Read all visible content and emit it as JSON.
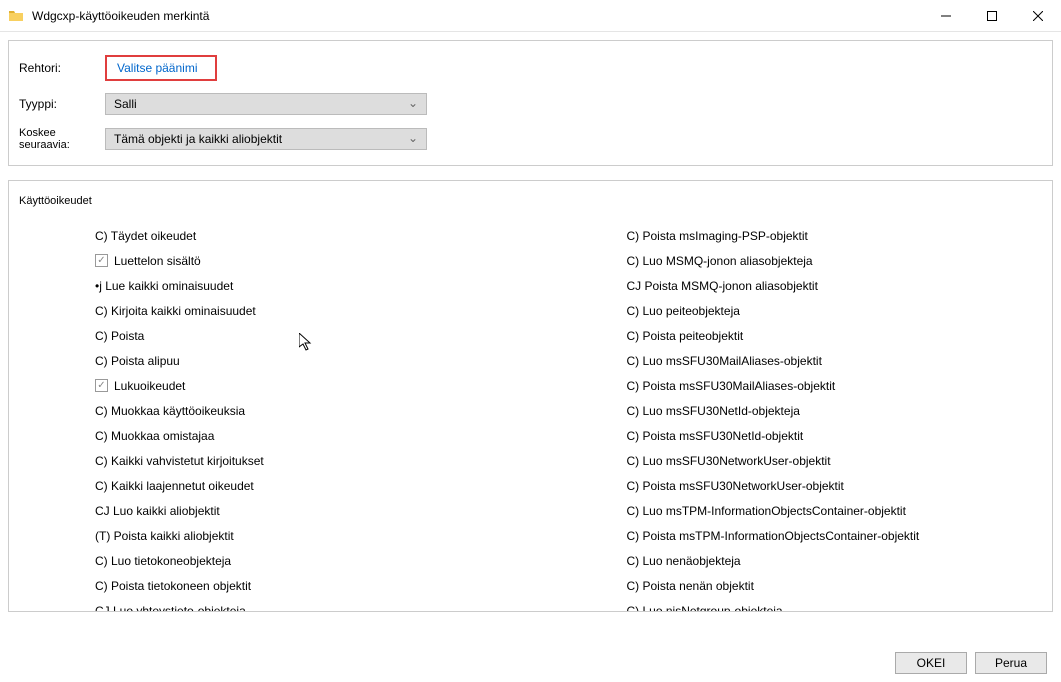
{
  "window": {
    "title": "Wdgcxp-käyttöoikeuden merkintä"
  },
  "fields": {
    "principal_label": "Rehtori:",
    "principal_link": "Valitse päänimi",
    "type_label": "Tyyppi:",
    "type_value": "Salli",
    "applies_label": "Koskee seuraavia:",
    "applies_value": "Tämä objekti ja kaikki aliobjektit"
  },
  "permissions": {
    "title": "Käyttöoikeudet",
    "left": [
      {
        "prefix": "C)",
        "label": "Täydet oikeudet",
        "checkbox": false
      },
      {
        "prefix": "",
        "label": "Luettelon sisältö",
        "checkbox": true,
        "checked": true
      },
      {
        "prefix": "•j",
        "label": "Lue kaikki ominaisuudet",
        "checkbox": false
      },
      {
        "prefix": "C)",
        "label": "Kirjoita kaikki ominaisuudet",
        "checkbox": false
      },
      {
        "prefix": "C)",
        "label": "Poista",
        "checkbox": false
      },
      {
        "prefix": "C)",
        "label": "Poista alipuu",
        "checkbox": false
      },
      {
        "prefix": "",
        "label": "Lukuoikeudet",
        "checkbox": true,
        "checked": true
      },
      {
        "prefix": "C)",
        "label": "Muokkaa käyttöoikeuksia",
        "checkbox": false
      },
      {
        "prefix": "C)",
        "label": "Muokkaa omistajaa",
        "checkbox": false
      },
      {
        "prefix": "C)",
        "label": "Kaikki vahvistetut kirjoitukset",
        "checkbox": false
      },
      {
        "prefix": "C)",
        "label": "Kaikki laajennetut oikeudet",
        "checkbox": false
      },
      {
        "prefix": "CJ",
        "label": "Luo kaikki aliobjektit",
        "checkbox": false
      },
      {
        "prefix": "(T)",
        "label": "Poista kaikki aliobjektit",
        "checkbox": false
      },
      {
        "prefix": "C)",
        "label": "Luo tietokoneobjekteja",
        "checkbox": false
      },
      {
        "prefix": "C)",
        "label": "Poista tietokoneen objektit",
        "checkbox": false
      },
      {
        "prefix": "CJ",
        "label": "Luo yhteystieto-objekteja",
        "checkbox": false
      }
    ],
    "right": [
      {
        "prefix": "C)",
        "label": "Poista msImaging-PSP-objektit",
        "checkbox": false
      },
      {
        "prefix": "C)",
        "label": "Luo MSMQ-jonon aliasobjekteja",
        "checkbox": false
      },
      {
        "prefix": "CJ",
        "label": "Poista MSMQ-jonon aliasobjektit",
        "checkbox": false
      },
      {
        "prefix": "C)",
        "label": "Luo peiteobjekteja",
        "checkbox": false
      },
      {
        "prefix": "C)",
        "label": "Poista peiteobjektit",
        "checkbox": false
      },
      {
        "prefix": "C)",
        "label": "Luo msSFU30MailAliases-objektit",
        "checkbox": false
      },
      {
        "prefix": "C)",
        "label": "Poista msSFU30MailAliases-objektit",
        "checkbox": false
      },
      {
        "prefix": "C)",
        "label": "Luo msSFU30NetId-objekteja",
        "checkbox": false
      },
      {
        "prefix": "C)",
        "label": "Poista msSFU30NetId-objektit",
        "checkbox": false
      },
      {
        "prefix": "C)",
        "label": "Luo msSFU30NetworkUser-objektit",
        "checkbox": false
      },
      {
        "prefix": "C)",
        "label": "Poista msSFU30NetworkUser-objektit",
        "checkbox": false
      },
      {
        "prefix": "C)",
        "label": "Luo msTPM-InformationObjectsContainer-objektit",
        "checkbox": false
      },
      {
        "prefix": "C)",
        "label": "Poista msTPM-InformationObjectsContainer-objektit",
        "checkbox": false
      },
      {
        "prefix": "C)",
        "label": "Luo nenäobjekteja",
        "checkbox": false
      },
      {
        "prefix": "C)",
        "label": "Poista nenän objektit",
        "checkbox": false
      },
      {
        "prefix": "C)",
        "label": "Luo nisNetgroup-objekteja",
        "checkbox": false
      }
    ]
  },
  "buttons": {
    "ok": "OKEI",
    "cancel": "Perua"
  }
}
